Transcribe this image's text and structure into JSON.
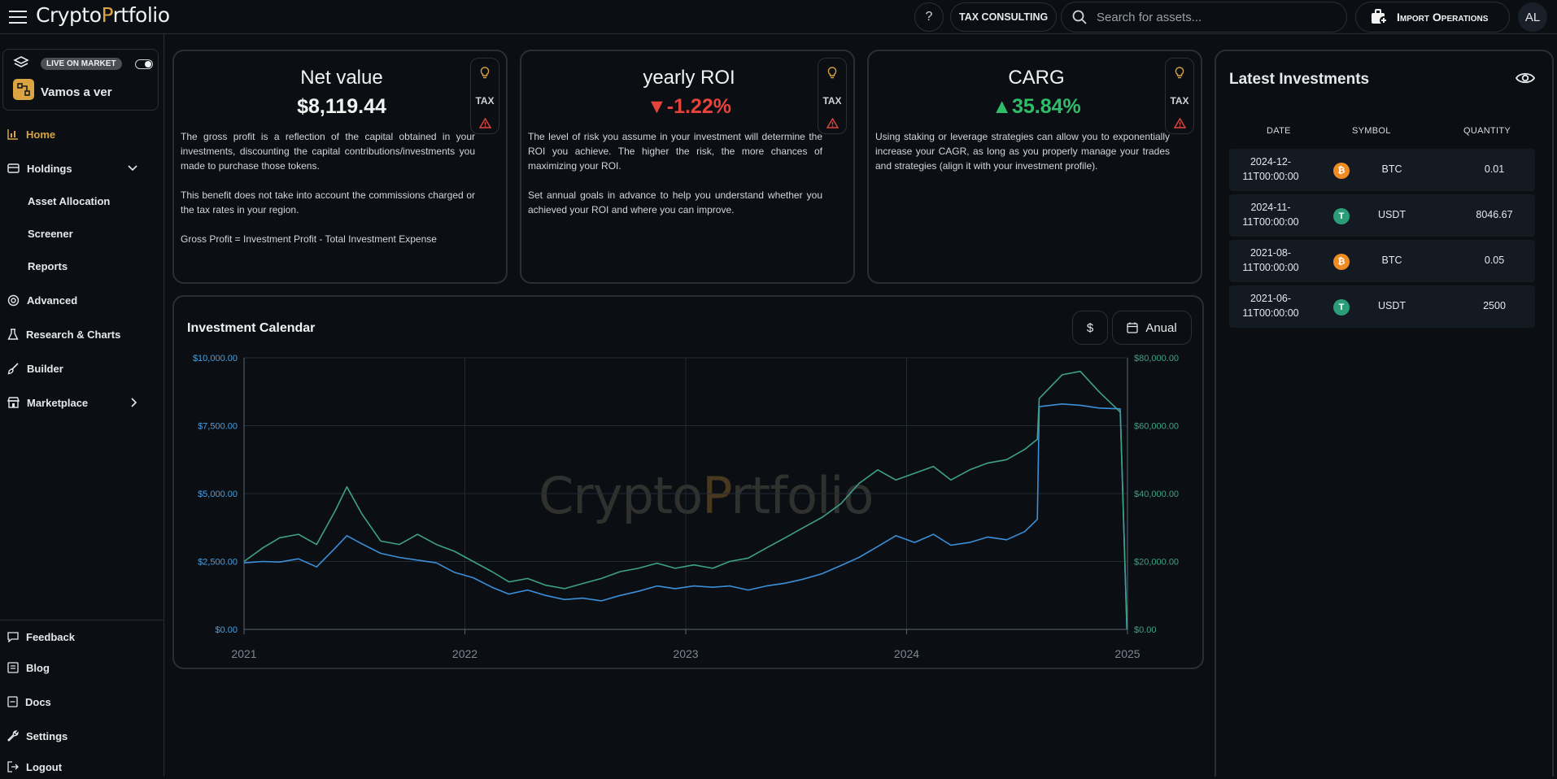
{
  "header": {
    "logo_left": "Crypto",
    "logo_o": "P",
    "logo_right": "rtfolio",
    "help_label": "?",
    "tax_consulting": "TAX CONSULTING",
    "search_placeholder": "Search for assets...",
    "import_label": "Import Operations",
    "avatar_initials": "AL"
  },
  "sidebar": {
    "live_badge": "LIVE ON MARKET",
    "portfolio_name": "Vamos a ver",
    "nav": {
      "home": "Home",
      "holdings": "Holdings",
      "asset_allocation": "Asset Allocation",
      "screener": "Screener",
      "reports": "Reports",
      "advanced": "Advanced",
      "research": "Research & Charts",
      "builder": "Builder",
      "marketplace": "Marketplace"
    },
    "footer": {
      "feedback": "Feedback",
      "blog": "Blog",
      "docs": "Docs",
      "settings": "Settings",
      "logout": "Logout"
    }
  },
  "cards": {
    "tax_label": "TAX",
    "net_value": {
      "title": "Net value",
      "value": "$8,119.44",
      "desc": "The gross profit is a reflection of the capital obtained in your investments, discounting the capital contributions/investments you made to purchase those tokens.\n\nThis benefit does not take into account the commissions charged or the tax rates in your region.\n\nGross Profit = Investment Profit - Total Investment Expense"
    },
    "roi": {
      "title": "yearly ROI",
      "value": "▼-1.22%",
      "desc": "The level of risk you assume in your investment will determine the ROI you achieve. The higher the risk, the more chances of maximizing your ROI.\n\nSet annual goals in advance to help you understand whether you achieved your ROI and where you can improve."
    },
    "cagr": {
      "title": "CARG",
      "value": "▲35.84%",
      "desc": "Using staking or leverage strategies can allow you to exponentially increase your CAGR, as long as you properly manage your trades and strategies (align it with your investment profile)."
    },
    "colors": {
      "positive": "#2fbd6a",
      "negative": "#e5443c",
      "accent": "#d9a441"
    }
  },
  "calendar": {
    "title": "Investment Calendar",
    "currency_btn": "$",
    "period_btn": "Anual",
    "watermark_left": "Crypto",
    "watermark_o": "P",
    "watermark_right": "rtfolio"
  },
  "chart_data": {
    "type": "line",
    "x_ticks": [
      "2021",
      "2022",
      "2023",
      "2024",
      "2025"
    ],
    "left_axis": {
      "ticks": [
        "$0.00",
        "$2,500.00",
        "$5,000.00",
        "$7,500.00",
        "$10,000.00"
      ],
      "ylim": [
        0,
        10000
      ],
      "color": "#4a9fe0"
    },
    "right_axis": {
      "ticks": [
        "$0.00",
        "$20,000.00",
        "$40,000.00",
        "$60,000.00",
        "$80,000.00"
      ],
      "ylim": [
        0,
        80000
      ],
      "color": "#3fa08a"
    },
    "grid": true,
    "series": [
      {
        "axis": "left",
        "color": "#3b8fd8",
        "points": [
          [
            "2021-01-01",
            2450
          ],
          [
            "2021-02-01",
            2500
          ],
          [
            "2021-03-01",
            2480
          ],
          [
            "2021-04-01",
            2600
          ],
          [
            "2021-05-01",
            2300
          ],
          [
            "2021-06-01",
            3000
          ],
          [
            "2021-06-20",
            3450
          ],
          [
            "2021-07-15",
            3150
          ],
          [
            "2021-08-15",
            2800
          ],
          [
            "2021-09-15",
            2650
          ],
          [
            "2021-10-15",
            2550
          ],
          [
            "2021-11-15",
            2450
          ],
          [
            "2021-12-15",
            2100
          ],
          [
            "2022-01-15",
            1900
          ],
          [
            "2022-02-15",
            1550
          ],
          [
            "2022-03-15",
            1300
          ],
          [
            "2022-04-15",
            1450
          ],
          [
            "2022-05-15",
            1250
          ],
          [
            "2022-06-15",
            1100
          ],
          [
            "2022-07-15",
            1150
          ],
          [
            "2022-08-15",
            1050
          ],
          [
            "2022-09-15",
            1250
          ],
          [
            "2022-10-15",
            1400
          ],
          [
            "2022-11-15",
            1600
          ],
          [
            "2022-12-15",
            1500
          ],
          [
            "2023-01-15",
            1600
          ],
          [
            "2023-02-15",
            1550
          ],
          [
            "2023-03-15",
            1600
          ],
          [
            "2023-04-15",
            1450
          ],
          [
            "2023-05-15",
            1600
          ],
          [
            "2023-06-15",
            1700
          ],
          [
            "2023-07-15",
            1850
          ],
          [
            "2023-08-15",
            2050
          ],
          [
            "2023-09-15",
            2350
          ],
          [
            "2023-10-15",
            2650
          ],
          [
            "2023-11-15",
            3050
          ],
          [
            "2023-12-15",
            3450
          ],
          [
            "2024-01-15",
            3200
          ],
          [
            "2024-02-15",
            3500
          ],
          [
            "2024-03-15",
            3100
          ],
          [
            "2024-04-15",
            3200
          ],
          [
            "2024-05-15",
            3400
          ],
          [
            "2024-06-15",
            3300
          ],
          [
            "2024-07-15",
            3600
          ],
          [
            "2024-08-05",
            4050
          ],
          [
            "2024-08-08",
            8200
          ],
          [
            "2024-09-15",
            8300
          ],
          [
            "2024-10-15",
            8250
          ],
          [
            "2024-11-15",
            8150
          ],
          [
            "2024-12-20",
            8119
          ],
          [
            "2024-12-31",
            0
          ]
        ]
      },
      {
        "axis": "right",
        "color": "#3fa08a",
        "points": [
          [
            "2021-01-01",
            20000
          ],
          [
            "2021-02-01",
            24000
          ],
          [
            "2021-03-01",
            27000
          ],
          [
            "2021-04-01",
            28000
          ],
          [
            "2021-05-01",
            25000
          ],
          [
            "2021-06-01",
            35000
          ],
          [
            "2021-06-20",
            42000
          ],
          [
            "2021-07-15",
            34000
          ],
          [
            "2021-08-15",
            26000
          ],
          [
            "2021-09-15",
            25000
          ],
          [
            "2021-10-15",
            28000
          ],
          [
            "2021-11-15",
            25000
          ],
          [
            "2021-12-15",
            23000
          ],
          [
            "2022-01-15",
            20000
          ],
          [
            "2022-02-15",
            17000
          ],
          [
            "2022-03-15",
            14000
          ],
          [
            "2022-04-15",
            15000
          ],
          [
            "2022-05-15",
            13000
          ],
          [
            "2022-06-15",
            12000
          ],
          [
            "2022-07-15",
            13500
          ],
          [
            "2022-08-15",
            15000
          ],
          [
            "2022-09-15",
            17000
          ],
          [
            "2022-10-15",
            18000
          ],
          [
            "2022-11-15",
            19500
          ],
          [
            "2022-12-15",
            18000
          ],
          [
            "2023-01-15",
            19000
          ],
          [
            "2023-02-15",
            18000
          ],
          [
            "2023-03-15",
            20000
          ],
          [
            "2023-04-15",
            21000
          ],
          [
            "2023-05-15",
            24000
          ],
          [
            "2023-06-15",
            27000
          ],
          [
            "2023-07-15",
            30000
          ],
          [
            "2023-08-15",
            33000
          ],
          [
            "2023-09-15",
            37000
          ],
          [
            "2023-10-15",
            43000
          ],
          [
            "2023-11-15",
            47000
          ],
          [
            "2023-12-15",
            44000
          ],
          [
            "2024-01-15",
            46000
          ],
          [
            "2024-02-15",
            48000
          ],
          [
            "2024-03-15",
            44000
          ],
          [
            "2024-04-15",
            47000
          ],
          [
            "2024-05-15",
            49000
          ],
          [
            "2024-06-15",
            50000
          ],
          [
            "2024-07-15",
            53000
          ],
          [
            "2024-08-05",
            56000
          ],
          [
            "2024-08-08",
            68000
          ],
          [
            "2024-09-15",
            75000
          ],
          [
            "2024-10-15",
            76000
          ],
          [
            "2024-11-15",
            70000
          ],
          [
            "2024-12-20",
            64000
          ],
          [
            "2024-12-31",
            0
          ]
        ]
      }
    ]
  },
  "latest": {
    "title": "Latest Investments",
    "headers": {
      "date": "DATE",
      "symbol": "SYMBOL",
      "quantity": "QUANTITY"
    },
    "rows": [
      {
        "date_line1": "2024-12-",
        "date_line2": "11T00:00:00",
        "coin_icon": "bitcoin-icon",
        "coin_glyph": "₿",
        "coin_color": "#f08c24",
        "symbol": "BTC",
        "quantity": "0.01"
      },
      {
        "date_line1": "2024-11-",
        "date_line2": "11T00:00:00",
        "coin_icon": "tether-icon",
        "coin_glyph": "T",
        "coin_color": "#2a9d78",
        "symbol": "USDT",
        "quantity": "8046.67"
      },
      {
        "date_line1": "2021-08-",
        "date_line2": "11T00:00:00",
        "coin_icon": "bitcoin-icon",
        "coin_glyph": "₿",
        "coin_color": "#f08c24",
        "symbol": "BTC",
        "quantity": "0.05"
      },
      {
        "date_line1": "2021-06-",
        "date_line2": "11T00:00:00",
        "coin_icon": "tether-icon",
        "coin_glyph": "T",
        "coin_color": "#2a9d78",
        "symbol": "USDT",
        "quantity": "2500"
      }
    ]
  }
}
